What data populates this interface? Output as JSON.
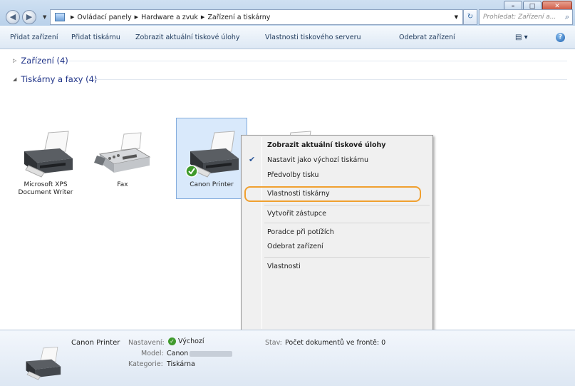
{
  "window": {
    "minimize_glyph": "–",
    "maximize_glyph": "□",
    "close_glyph": "✕"
  },
  "nav": {
    "back_glyph": "◀",
    "forward_glyph": "▶"
  },
  "address": {
    "crumbs": [
      "Ovládací panely",
      "Hardware a zvuk",
      "Zařízení a tiskárny"
    ],
    "search_placeholder": "Prohledat: Zařízení a..."
  },
  "toolbar": {
    "items": [
      "Přidat zařízení",
      "Přidat tiskárnu",
      "Zobrazit aktuální tiskové úlohy",
      "Vlastnosti tiskového serveru",
      "Odebrat zařízení"
    ]
  },
  "groups": {
    "devices": "Zařízení (4)",
    "printers": "Tiskárny a faxy (4)"
  },
  "printers": [
    {
      "label": "Microsoft XPS Document Writer"
    },
    {
      "label": "Fax"
    },
    {
      "label": "Canon Printer"
    },
    {
      "label": ""
    }
  ],
  "context_menu": {
    "items": [
      {
        "label": "Zobrazit aktuální tiskové úlohy",
        "bold": true
      },
      {
        "label": "Nastavit jako výchozí tiskárnu",
        "checked": true
      },
      {
        "label": "Předvolby tisku"
      },
      {
        "label": "Vlastnosti tiskárny",
        "highlighted": true
      },
      {
        "label": "Vytvořit zástupce"
      },
      {
        "label": "Poradce při potížích"
      },
      {
        "label": "Odebrat zařízení"
      },
      {
        "label": "Vlastnosti"
      }
    ]
  },
  "details": {
    "name": "Canon Printer",
    "status_label": "Nastavení:",
    "status_value": "Výchozí",
    "model_label": "Model:",
    "model_value": "Canon",
    "category_label": "Kategorie:",
    "category_value": "Tiskárna",
    "state_label": "Stav:",
    "state_value": "Počet dokumentů ve frontě: 0"
  },
  "colors": {
    "accent_highlight": "#f0a030",
    "selection_bg": "#d9e9fb",
    "group_header": "#1e3287"
  }
}
